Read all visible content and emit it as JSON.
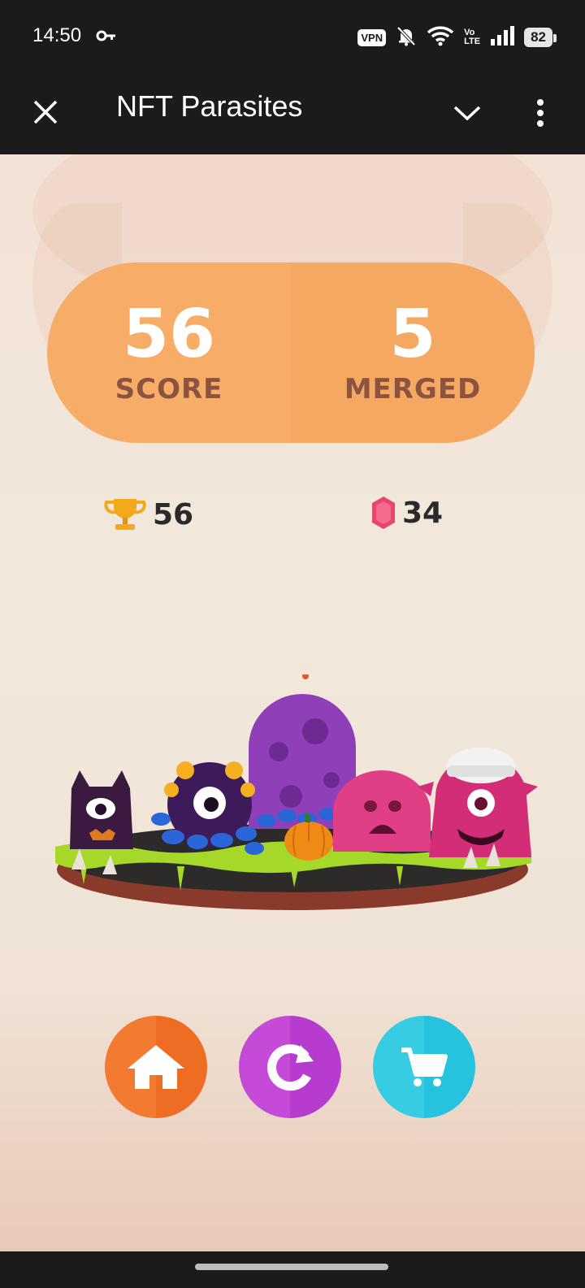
{
  "status_bar": {
    "time": "14:50",
    "vpn_label": "VPN",
    "volte_label_top": "Vo",
    "volte_label_bottom": "LTE",
    "battery_level": "82",
    "icons": [
      "key-icon",
      "silent-bell-icon",
      "wifi-icon",
      "signal-icon",
      "battery-icon"
    ]
  },
  "app_bar": {
    "title": "NFT Parasites",
    "icons": [
      "close-icon",
      "chevron-down-icon",
      "more-vert-icon"
    ]
  },
  "score_panel": {
    "score_value": "56",
    "score_label": "SCORE",
    "merged_value": "5",
    "merged_label": "MERGED"
  },
  "stats": {
    "best_score": "56",
    "gems": "34"
  },
  "actions": {
    "icons": [
      "home-icon",
      "restart-icon",
      "cart-icon"
    ]
  },
  "colors": {
    "score_panel": "#f7ad67",
    "score_label": "#8a5440",
    "home_button": "#f37a31",
    "restart_button": "#c44ad7",
    "shop_button": "#36cde4"
  }
}
